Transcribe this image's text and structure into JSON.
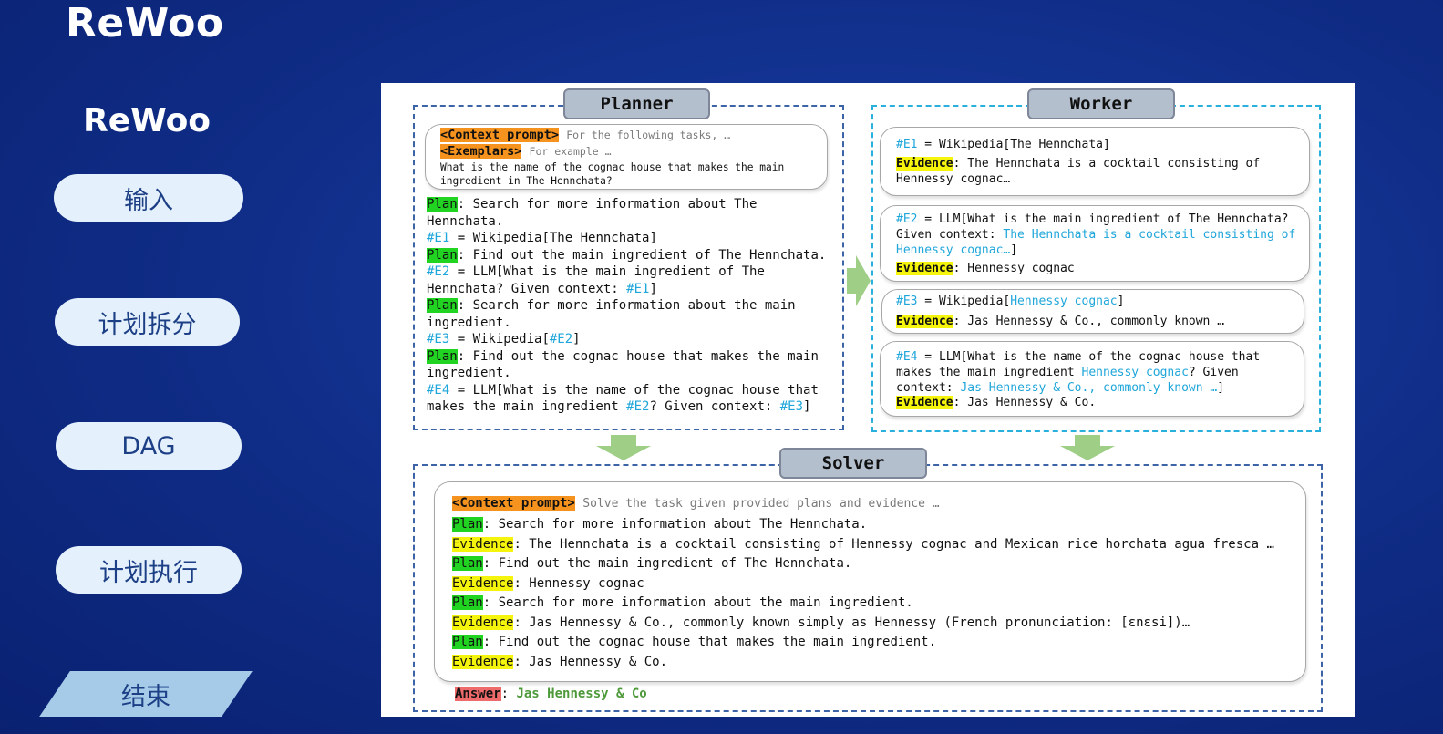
{
  "page": {
    "title": "ReWoo",
    "subtitle": "ReWoo"
  },
  "nav": [
    {
      "label": "输入"
    },
    {
      "label": "计划拆分"
    },
    {
      "label": "DAG"
    },
    {
      "label": "计划执行"
    },
    {
      "label": "结束"
    }
  ],
  "diagram": {
    "planner": {
      "title": "Planner",
      "context_tag": "<Context prompt>",
      "context_text": "For the following tasks, …",
      "exemplars_tag": "<Exemplars>",
      "exemplars_text": "For example …",
      "question_line1": "What is the name of the cognac house that makes the main",
      "question_line2": "ingredient in The Hennchata?",
      "plan_tag": "Plan",
      "plan1_a": ": Search for more information about The",
      "plan1_b": "Hennchata.",
      "e1_tag": "#E1",
      "e1_text": " = Wikipedia[The Hennchata]",
      "plan2": ": Find out the main ingredient of The Hennchata.",
      "e2_tag": "#E2",
      "e2_text_a": " = LLM[What is the main ingredient of The",
      "e2_text_b": "Hennchata? Given context: ",
      "e2_ref": "#E1",
      "close_bracket": "]",
      "plan3_a": ": Search for more information about the main",
      "plan3_b": "ingredient.",
      "e3_tag": "#E3",
      "e3_text": " = Wikipedia[",
      "e3_ref": "#E2",
      "plan4_a": ": Find out the cognac house that makes the main",
      "plan4_b": "ingredient.",
      "e4_tag": "#E4",
      "e4_text_a": " = LLM[What is the name of the cognac house that",
      "e4_text_b": "makes the main ingredient ",
      "e4_ref1": "#E2",
      "e4_text_c": "? Given context: ",
      "e4_ref2": "#E3"
    },
    "worker": {
      "title": "Worker",
      "evidence_tag": "Evidence",
      "w1_tag": "#E1",
      "w1_text": " = Wikipedia[The Hennchata]",
      "w1_ev_a": ": The Hennchata is a cocktail consisting of",
      "w1_ev_b": "Hennessy cognac…",
      "w2_tag": "#E2",
      "w2_text_a": " = LLM[What is the main ingredient of The Hennchata?",
      "w2_text_b": "Given context: ",
      "w2_cy_a": "The Hennchata is a cocktail consisting of",
      "w2_cy_b": "Hennessy cognac…",
      "w2_ev": ": Hennessy cognac",
      "w3_tag": "#E3",
      "w3_text": " = Wikipedia[",
      "w3_cy": "Hennessy cognac",
      "w3_ev": ": Jas Hennessy & Co., commonly known …",
      "w4_tag": "#E4",
      "w4_text_a": " = LLM[What is the name of the cognac house that",
      "w4_text_b": "makes the main ingredient ",
      "w4_cy1": "Hennessy cognac",
      "w4_text_c": "? Given",
      "w4_text_d": "context: ",
      "w4_cy2": "Jas Hennessy & Co., commonly known …",
      "w4_ev": ": Jas Hennessy & Co."
    },
    "solver": {
      "title": "Solver",
      "context_tag": "<Context prompt>",
      "context_text": "Solve the task given provided plans and evidence …",
      "s1": ": Search for more information about The Hennchata.",
      "s2": ": The Hennchata is a cocktail consisting of Hennessy cognac and Mexican rice horchata agua fresca …",
      "s3": ": Find out the main ingredient of The Hennchata.",
      "s4": ": Hennessy cognac",
      "s5": ": Search for more information about the main ingredient.",
      "s6": ": Jas Hennessy & Co., commonly known simply as Hennessy (French pronunciation: [ɛnɛsi])…",
      "s7": ": Find out the cognac house that makes the main ingredient.",
      "s8": ": Jas Hennessy & Co.",
      "answer_tag": "Answer",
      "colon": ": ",
      "answer": "Jas Hennessy & Co"
    }
  },
  "colors": {
    "background": "#0f2c86",
    "pill": "#e4f0fb",
    "active_pill": "#a5cbe8",
    "highlight_orange": "#f6931e",
    "highlight_green": "#21d421",
    "highlight_yellow": "#f4f40d",
    "highlight_red": "#ef6a6a",
    "ref_cyan": "#1fa6da",
    "arrow_green": "#9fcf87"
  }
}
